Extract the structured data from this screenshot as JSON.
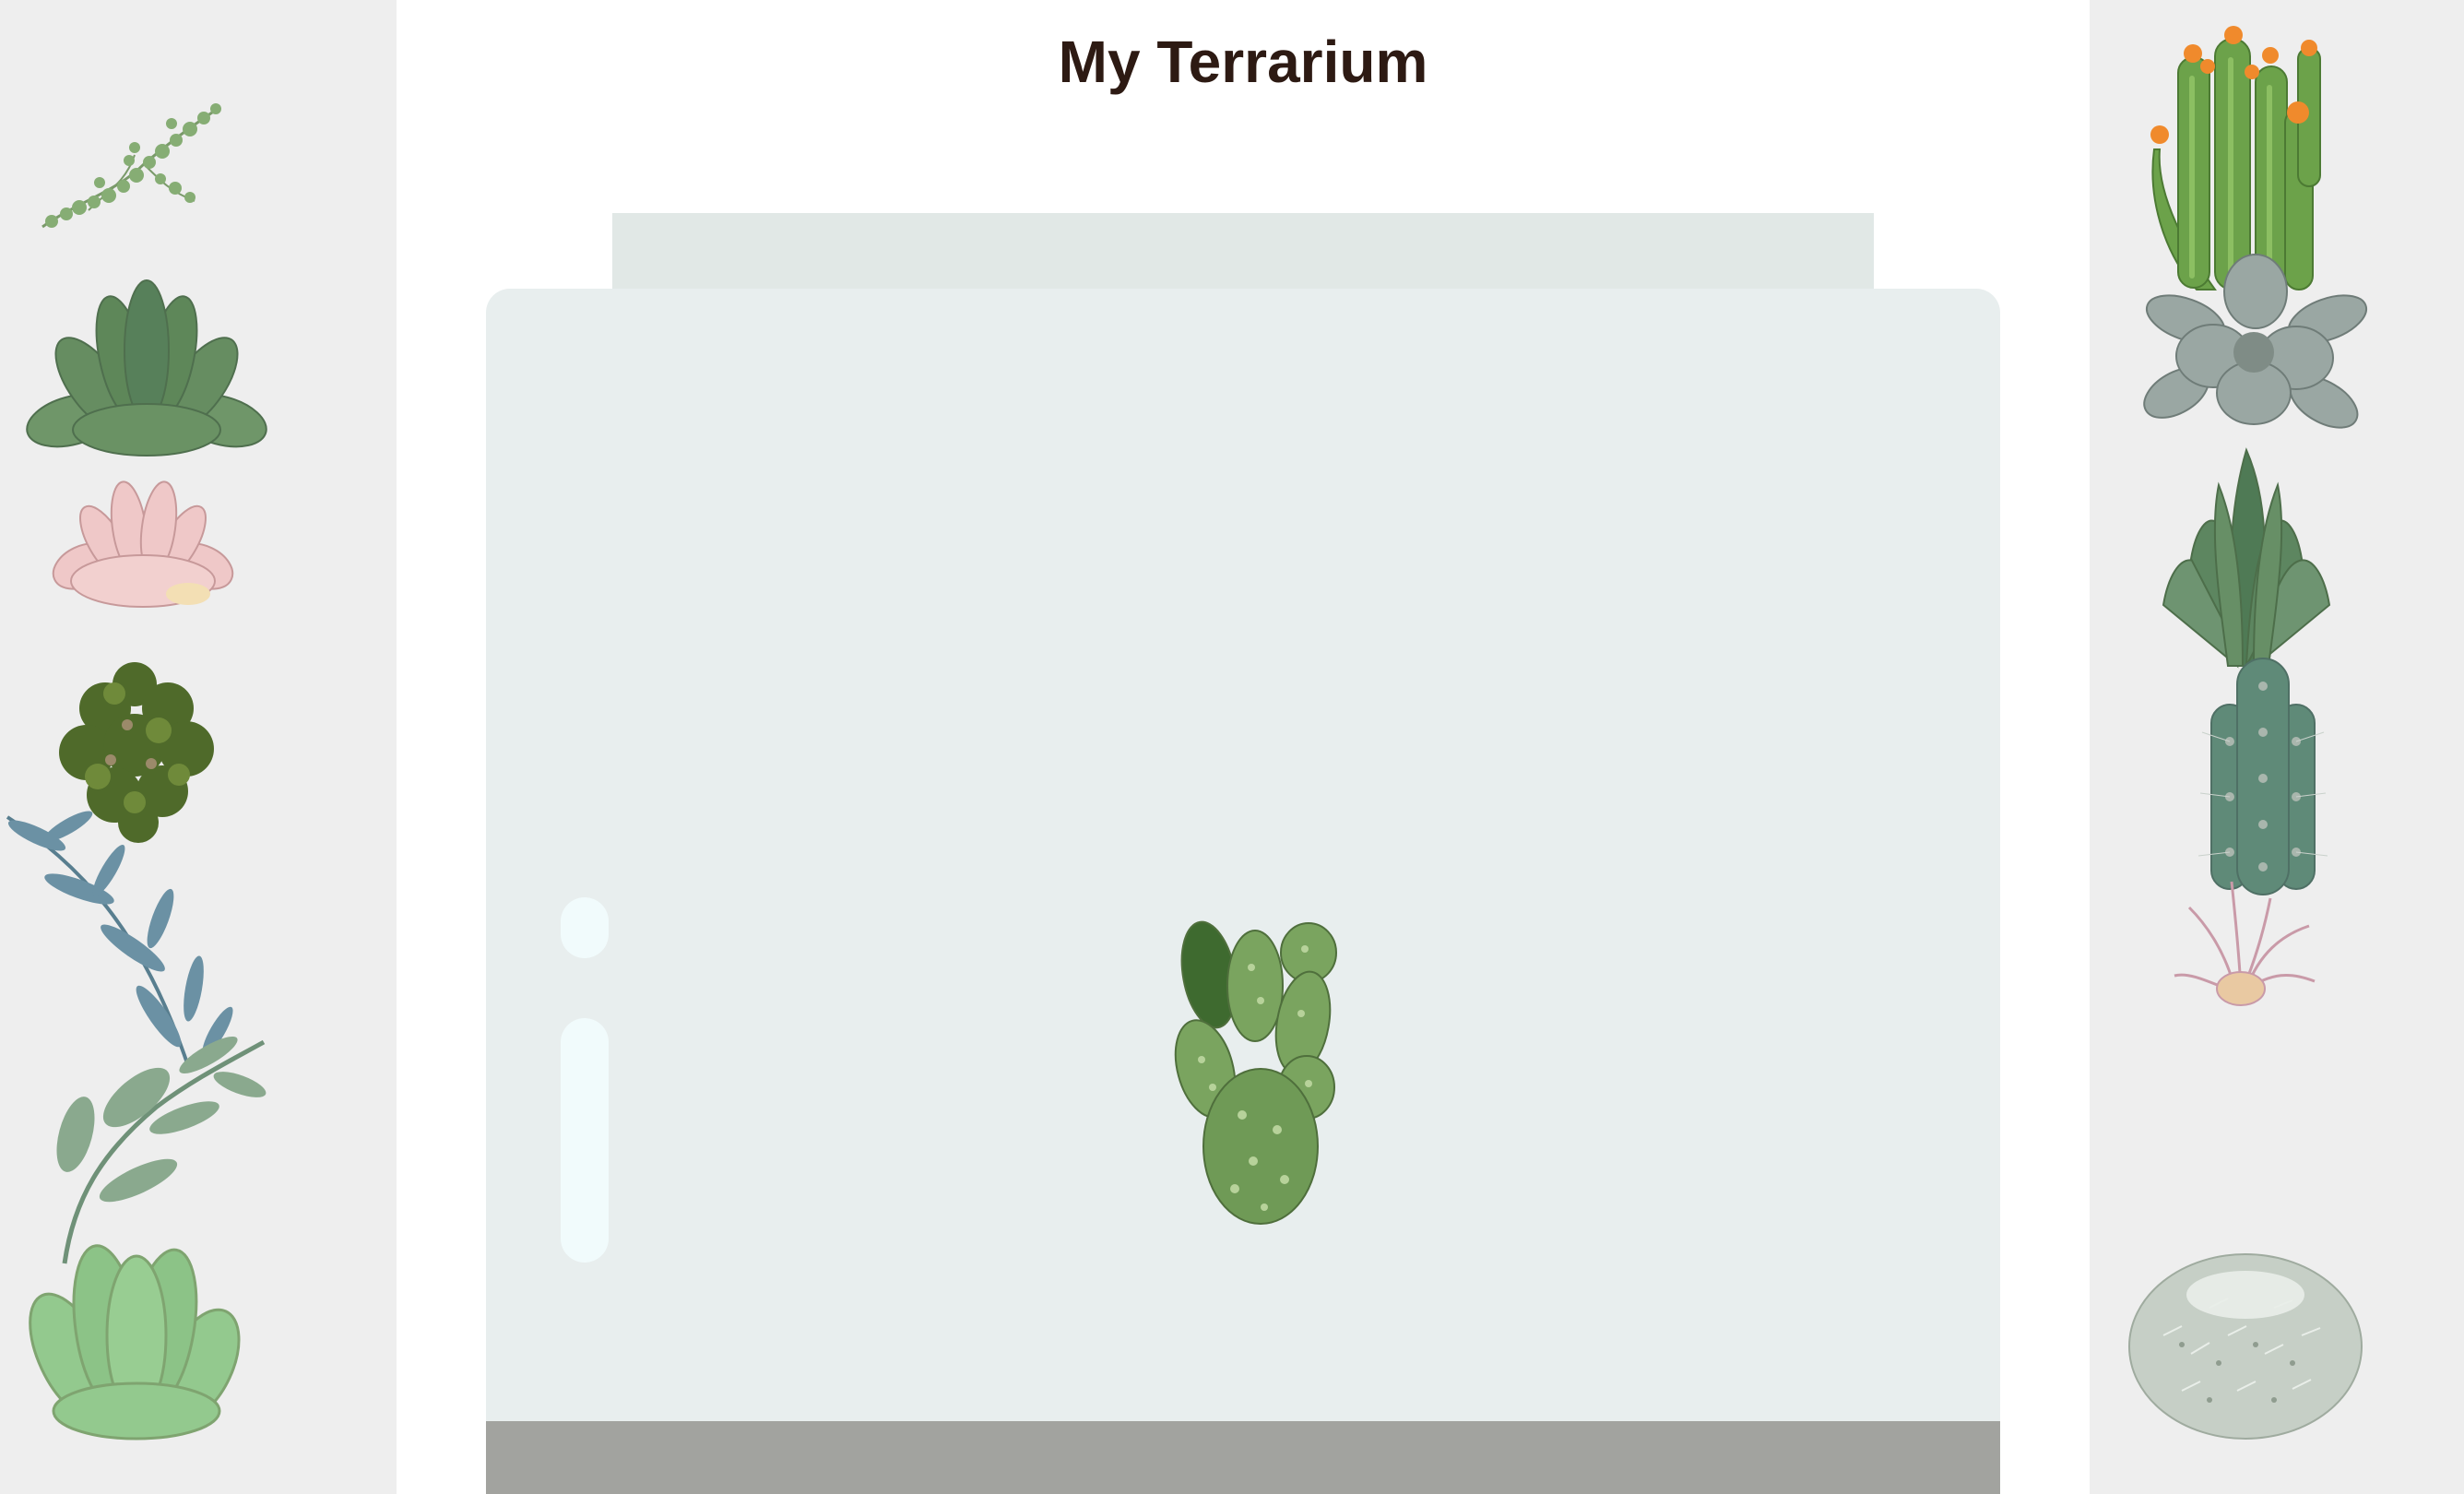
{
  "page": {
    "title": "My Terrarium"
  },
  "colors": {
    "title": "#2d1a13",
    "side_panel": "#eeeeee",
    "jar_top": "#e1e8e6",
    "jar_glass": "#e8eeee",
    "jar_glare": "#f1fbfc",
    "jar_bottom": "#a2a39f"
  },
  "left_plants": [
    {
      "id": "plant1",
      "icon": "string-of-pearls-icon"
    },
    {
      "id": "plant2",
      "icon": "green-echeveria-icon"
    },
    {
      "id": "plant3",
      "icon": "pink-echeveria-icon"
    },
    {
      "id": "plant4",
      "icon": "dark-succulent-cluster-icon"
    },
    {
      "id": "plant5",
      "icon": "blue-eucalyptus-sprig-icon"
    },
    {
      "id": "plant6",
      "icon": "green-leafy-stem-icon"
    },
    {
      "id": "plant7",
      "icon": "pale-green-succulent-icon"
    }
  ],
  "right_plants": [
    {
      "id": "plant8",
      "icon": "flowering-cactus-icon"
    },
    {
      "id": "plant9",
      "icon": "grey-rosette-succulent-icon"
    },
    {
      "id": "plant10",
      "icon": "spiky-aloe-icon"
    },
    {
      "id": "plant11",
      "icon": "columnar-cactus-icon"
    },
    {
      "id": "plant12",
      "icon": "air-plant-icon"
    },
    {
      "id": "plant13",
      "icon": "round-barrel-cactus-icon"
    }
  ],
  "jar_contents": [
    {
      "id": "plant14",
      "icon": "prickly-pear-cactus-icon"
    }
  ]
}
